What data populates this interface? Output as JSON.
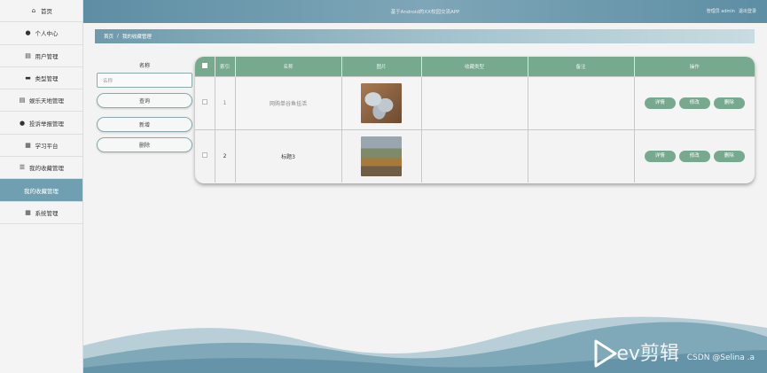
{
  "header": {
    "title": "基于Android的XX校园交流APP",
    "user_label": "管理员 admin",
    "logout_label": "退出登录"
  },
  "sidebar": {
    "items": [
      {
        "label": "首页",
        "icon": "home-icon"
      },
      {
        "label": "个人中心",
        "icon": "user-icon"
      },
      {
        "label": "用户管理",
        "icon": "clipboard-icon"
      },
      {
        "label": "类型管理",
        "icon": "monitor-icon"
      },
      {
        "label": "娱乐天地管理",
        "icon": "clipboard-icon"
      },
      {
        "label": "投诉举报管理",
        "icon": "user-icon"
      },
      {
        "label": "学习平台",
        "icon": "grid-icon"
      },
      {
        "label": "我的收藏管理",
        "icon": "sliders-icon"
      },
      {
        "label": "我的收藏管理",
        "icon": "",
        "active": true
      },
      {
        "label": "系统管理",
        "icon": "grid-icon"
      }
    ]
  },
  "breadcrumb": {
    "home": "首页",
    "separator": "/",
    "current": "我的收藏管理"
  },
  "search": {
    "label": "名称",
    "placeholder": "名称",
    "query_button": "查询",
    "add_button": "新增",
    "delete_button": "删除"
  },
  "table": {
    "headers": [
      "索引",
      "名称",
      "图片",
      "收藏类型",
      "备注",
      "操作"
    ],
    "rows": [
      {
        "index": "1",
        "name": "网购单谷鱼挂活",
        "image": "fish-photo",
        "type": "",
        "remark": ""
      },
      {
        "index": "2",
        "name": "标题3",
        "image": "street-photo",
        "type": "",
        "remark": ""
      }
    ],
    "actions": {
      "detail": "详情",
      "edit": "修改",
      "delete": "删除"
    }
  },
  "watermark": {
    "logo_text": "ev剪辑",
    "credit": "CSDN @Selina .a"
  },
  "colors": {
    "header": "#6f9fb0",
    "table_header": "#77a98f",
    "active_sidebar": "#6f9fb0"
  }
}
